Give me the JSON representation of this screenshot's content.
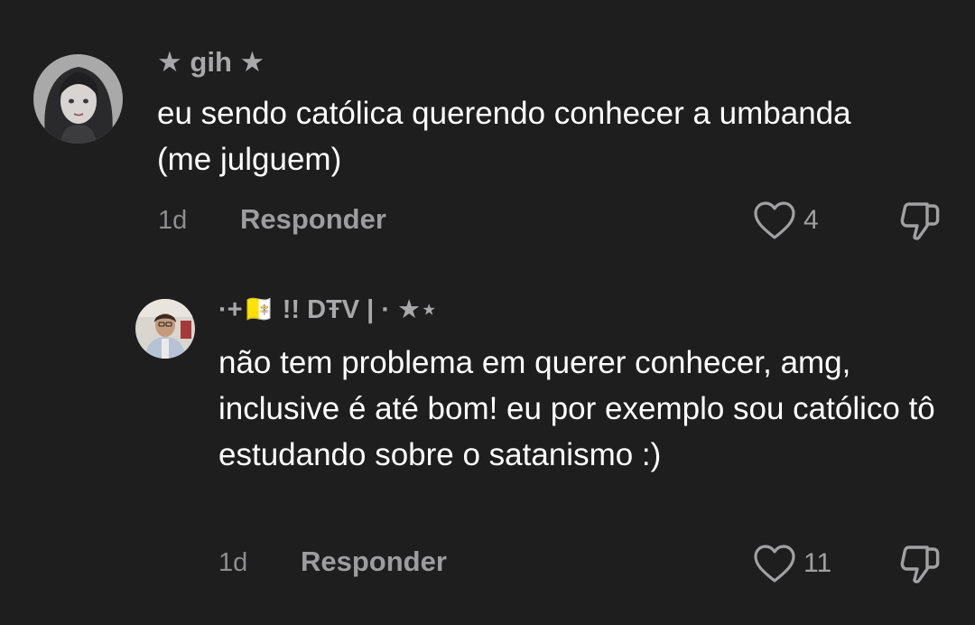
{
  "comments": [
    {
      "username": "★ gih ★",
      "text": "eu sendo católica querendo conhecer a umbanda (me julguem)",
      "time": "1d",
      "reply_label": "Responder",
      "likes": "4"
    }
  ],
  "replies": [
    {
      "username": "·+🇻🇦 !! DŦV | · ★⋆",
      "text": "não tem problema em querer conhecer, amg, inclusive é até bom! eu por exemplo sou católico tô estudando sobre o satanismo :)",
      "time": "1d",
      "reply_label": "Responder",
      "likes": "11"
    }
  ],
  "icons": {
    "like": "heart-outline-icon",
    "dislike": "thumbs-down-outline-icon"
  },
  "colors": {
    "background": "#1e1e1f",
    "text": "#ffffff",
    "username": "#a8a8aa",
    "meta": "#8e8e90"
  }
}
